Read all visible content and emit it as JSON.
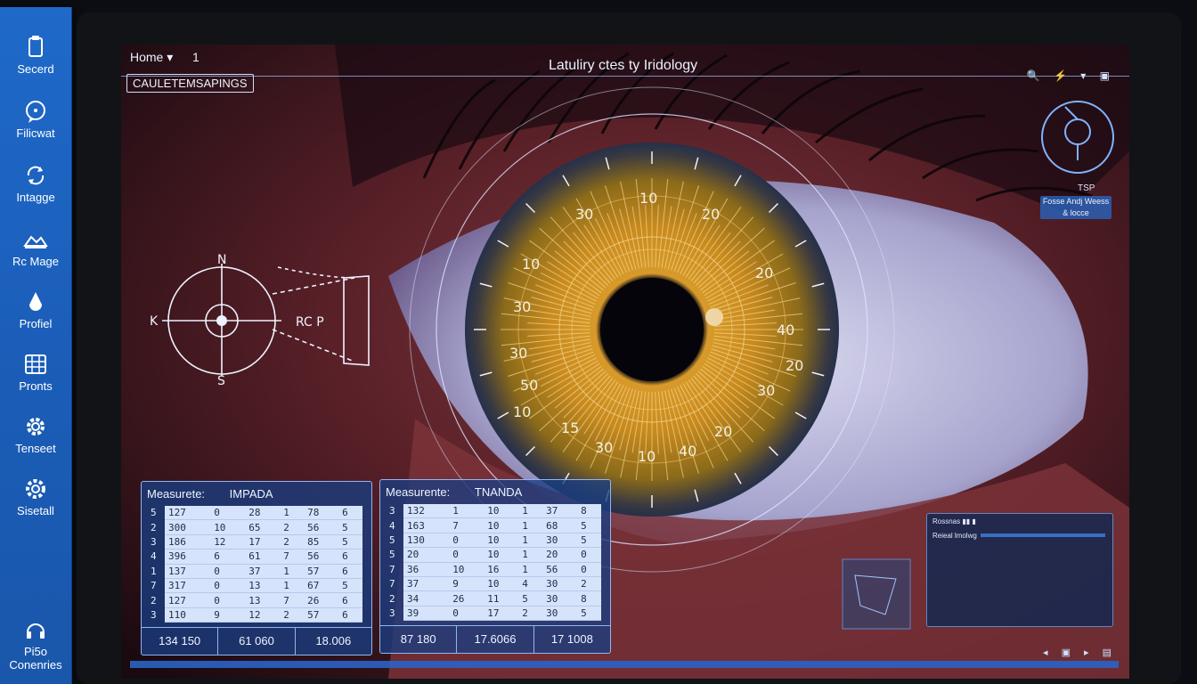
{
  "sidebar": {
    "items": [
      {
        "label": "Secerd",
        "icon": "clipboard-icon"
      },
      {
        "label": "Filicwat",
        "icon": "chat-icon"
      },
      {
        "label": "Intagge",
        "icon": "refresh-icon"
      },
      {
        "label": "Rc Mage",
        "icon": "image-icon"
      },
      {
        "label": "Profiel",
        "icon": "drop-icon"
      },
      {
        "label": "Pronts",
        "icon": "grid-icon"
      },
      {
        "label": "Tenseet",
        "icon": "gear-icon"
      },
      {
        "label": "Sisetall",
        "icon": "settings-icon"
      }
    ],
    "footer": {
      "line1": "Pi5o",
      "line2": "Conenries",
      "icon": "headset-icon"
    }
  },
  "topbar": {
    "home": "Home ▾",
    "page": "1",
    "title": "Latuliry ctes ty Iridology",
    "mode": "CAULETEMSAPINGS",
    "icons": "🔍 ⚡ ▾ ▣"
  },
  "diagram": {
    "n": "N",
    "s": "S",
    "k": "K",
    "label": "RC P"
  },
  "iris_labels": [
    "10",
    "20",
    "30",
    "10",
    "20",
    "30",
    "40",
    "50",
    "30",
    "10",
    "30",
    "15",
    "20",
    "40",
    "10",
    "20",
    "30"
  ],
  "panel1": {
    "header": "Measurete:",
    "value": "IMPADA",
    "rows": [
      [
        "5",
        "127",
        "0",
        "28",
        "1",
        "78",
        "6"
      ],
      [
        "2",
        "300",
        "10",
        "65",
        "2",
        "56",
        "5"
      ],
      [
        "3",
        "186",
        "12",
        "17",
        "2",
        "85",
        "5"
      ],
      [
        "4",
        "396",
        "6",
        "61",
        "7",
        "56",
        "6"
      ],
      [
        "1",
        "137",
        "0",
        "37",
        "1",
        "57",
        "6"
      ],
      [
        "7",
        "317",
        "0",
        "13",
        "1",
        "67",
        "5"
      ],
      [
        "2",
        "127",
        "0",
        "13",
        "7",
        "26",
        "6"
      ],
      [
        "3",
        "110",
        "9",
        "12",
        "2",
        "57",
        "6"
      ]
    ],
    "footer": [
      "134 150",
      "61 060",
      "18.006"
    ]
  },
  "panel2": {
    "header": "Measurente:",
    "value": "TNANDA",
    "rows": [
      [
        "3",
        "132",
        "1",
        "10",
        "1",
        "37",
        "8"
      ],
      [
        "4",
        "163",
        "7",
        "10",
        "1",
        "68",
        "5"
      ],
      [
        "5",
        "130",
        "0",
        "10",
        "1",
        "30",
        "5"
      ],
      [
        "5",
        "20",
        "0",
        "10",
        "1",
        "20",
        "0"
      ],
      [
        "7",
        "36",
        "10",
        "16",
        "1",
        "56",
        "0"
      ],
      [
        "7",
        "37",
        "9",
        "10",
        "4",
        "30",
        "2"
      ],
      [
        "2",
        "34",
        "26",
        "11",
        "5",
        "30",
        "8"
      ],
      [
        "3",
        "39",
        "0",
        "17",
        "2",
        "30",
        "5"
      ]
    ],
    "footer": [
      "87 180",
      "17.6066",
      "17 1008"
    ]
  },
  "gauge": {
    "label": "TSP",
    "button": "Fosse Andj Weess & locce"
  },
  "data_panel": {
    "title": "Rossnas ▮▮ ▮",
    "sub": "Reieal lmolwg"
  }
}
